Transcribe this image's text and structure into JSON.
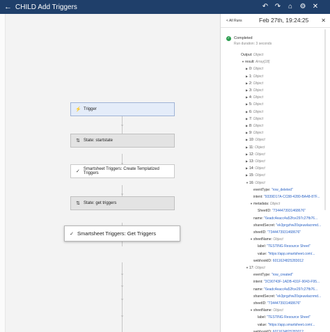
{
  "header": {
    "title": "CHILD Add Triggers",
    "icons": [
      "back-arrow-icon",
      "undo-icon",
      "redo-icon",
      "tag-icon",
      "settings-icon",
      "menu-icon"
    ]
  },
  "panel": {
    "all_runs": "< All Runs",
    "run_date": "Feb 27th, 19:24:25",
    "status": "Completed",
    "duration": "Run duration: 3 seconds"
  },
  "nodes": [
    {
      "label": "Trigger",
      "kind": "trigger",
      "icon": "bolt-icon"
    },
    {
      "label": "State: startstate",
      "kind": "state",
      "icon": "state-icon"
    },
    {
      "label": "Smartsheet Triggers: Create Templatized Triggers",
      "kind": "action",
      "icon": "smartsheet-icon"
    },
    {
      "label": "State: get triggers",
      "kind": "state",
      "icon": "state-icon"
    },
    {
      "label": "Smartsheet Triggers: Get Triggers",
      "kind": "action-selected",
      "icon": "smartsheet-icon"
    }
  ],
  "tree": [
    {
      "depth": 0,
      "caret": "",
      "key": "Output:",
      "type": "Object",
      "value": ""
    },
    {
      "depth": 1,
      "caret": "▼",
      "key": "result:",
      "type": "Array[18]",
      "value": ""
    },
    {
      "depth": 2,
      "caret": "▶",
      "key": "0:",
      "type": "Object",
      "value": ""
    },
    {
      "depth": 2,
      "caret": "▶",
      "key": "1:",
      "type": "Object",
      "value": ""
    },
    {
      "depth": 2,
      "caret": "▶",
      "key": "2:",
      "type": "Object",
      "value": ""
    },
    {
      "depth": 2,
      "caret": "▶",
      "key": "3:",
      "type": "Object",
      "value": ""
    },
    {
      "depth": 2,
      "caret": "▶",
      "key": "4:",
      "type": "Object",
      "value": ""
    },
    {
      "depth": 2,
      "caret": "▶",
      "key": "5:",
      "type": "Object",
      "value": ""
    },
    {
      "depth": 2,
      "caret": "▶",
      "key": "6:",
      "type": "Object",
      "value": ""
    },
    {
      "depth": 2,
      "caret": "▶",
      "key": "7:",
      "type": "Object",
      "value": ""
    },
    {
      "depth": 2,
      "caret": "▶",
      "key": "8:",
      "type": "Object",
      "value": ""
    },
    {
      "depth": 2,
      "caret": "▶",
      "key": "9:",
      "type": "Object",
      "value": ""
    },
    {
      "depth": 2,
      "caret": "▶",
      "key": "10:",
      "type": "Object",
      "value": ""
    },
    {
      "depth": 2,
      "caret": "▶",
      "key": "11:",
      "type": "Object",
      "value": ""
    },
    {
      "depth": 2,
      "caret": "▶",
      "key": "12:",
      "type": "Object",
      "value": ""
    },
    {
      "depth": 2,
      "caret": "▶",
      "key": "13:",
      "type": "Object",
      "value": ""
    },
    {
      "depth": 2,
      "caret": "▶",
      "key": "14:",
      "type": "Object",
      "value": ""
    },
    {
      "depth": 2,
      "caret": "▶",
      "key": "15:",
      "type": "Object",
      "value": ""
    },
    {
      "depth": 2,
      "caret": "▼",
      "key": "16:",
      "type": "Object",
      "value": ""
    },
    {
      "depth": 3,
      "caret": "",
      "key": "eventType:",
      "type": "",
      "value": "\"row_deleted\""
    },
    {
      "depth": 3,
      "caret": "",
      "key": "intent:",
      "type": "",
      "value": "\"9339D17A-CC88-4280-BA48-87F..."
    },
    {
      "depth": 3,
      "caret": "▼",
      "key": "metadata:",
      "type": "Object",
      "value": ""
    },
    {
      "depth": 4,
      "caret": "",
      "key": "SheetID:",
      "type": "",
      "value": "\"7344473931468676\""
    },
    {
      "depth": 3,
      "caret": "",
      "key": "name:",
      "type": "",
      "value": "\"6eadc4eacc4a52fce297c27fb76..."
    },
    {
      "depth": 3,
      "caret": "",
      "key": "sharedSecret:",
      "type": "",
      "value": "\"ek3prgzhw20sjeuwlacnmd..."
    },
    {
      "depth": 3,
      "caret": "",
      "key": "sheetID:",
      "type": "",
      "value": "\"7344473931468676\""
    },
    {
      "depth": 3,
      "caret": "▼",
      "key": "sheetName:",
      "type": "Object",
      "value": ""
    },
    {
      "depth": 4,
      "caret": "",
      "key": "label:",
      "type": "",
      "value": "\"TESTING Resource Sheet\""
    },
    {
      "depth": 4,
      "caret": "",
      "key": "value:",
      "type": "",
      "value": "\"https://app.smartsheet.com/..."
    },
    {
      "depth": 3,
      "caret": "",
      "key": "webhookID:",
      "type": "",
      "value": "6011624825283012"
    },
    {
      "depth": 2,
      "caret": "▼",
      "key": "17:",
      "type": "Object",
      "value": ""
    },
    {
      "depth": 3,
      "caret": "",
      "key": "eventType:",
      "type": "",
      "value": "\"row_created\""
    },
    {
      "depth": 3,
      "caret": "",
      "key": "intent:",
      "type": "",
      "value": "\"3C90743F-1ADB-431F-9043-F95..."
    },
    {
      "depth": 3,
      "caret": "",
      "key": "name:",
      "type": "",
      "value": "\"6eadc4eacc4a52fce297c27fb76..."
    },
    {
      "depth": 3,
      "caret": "",
      "key": "sharedSecret:",
      "type": "",
      "value": "\"ek3prgzhw20sjeuwlacnmd..."
    },
    {
      "depth": 3,
      "caret": "",
      "key": "sheetID:",
      "type": "",
      "value": "\"7344473931468676\""
    },
    {
      "depth": 3,
      "caret": "▼",
      "key": "sheetName:",
      "type": "Object",
      "value": ""
    },
    {
      "depth": 4,
      "caret": "",
      "key": "label:",
      "type": "",
      "value": "\"TESTING Resource Sheet\""
    },
    {
      "depth": 4,
      "caret": "",
      "key": "value:",
      "type": "",
      "value": "\"https://app.smartsheet.com/..."
    },
    {
      "depth": 3,
      "caret": "",
      "key": "webhookID:",
      "type": "",
      "value": "6011624825283012"
    }
  ],
  "colors": {
    "header_bg": "#1f3f6a",
    "completed": "#2c9d4f",
    "value_text": "#2b63c5",
    "trigger_node": "#e4ecf9",
    "state_node": "#e3e3e3"
  }
}
